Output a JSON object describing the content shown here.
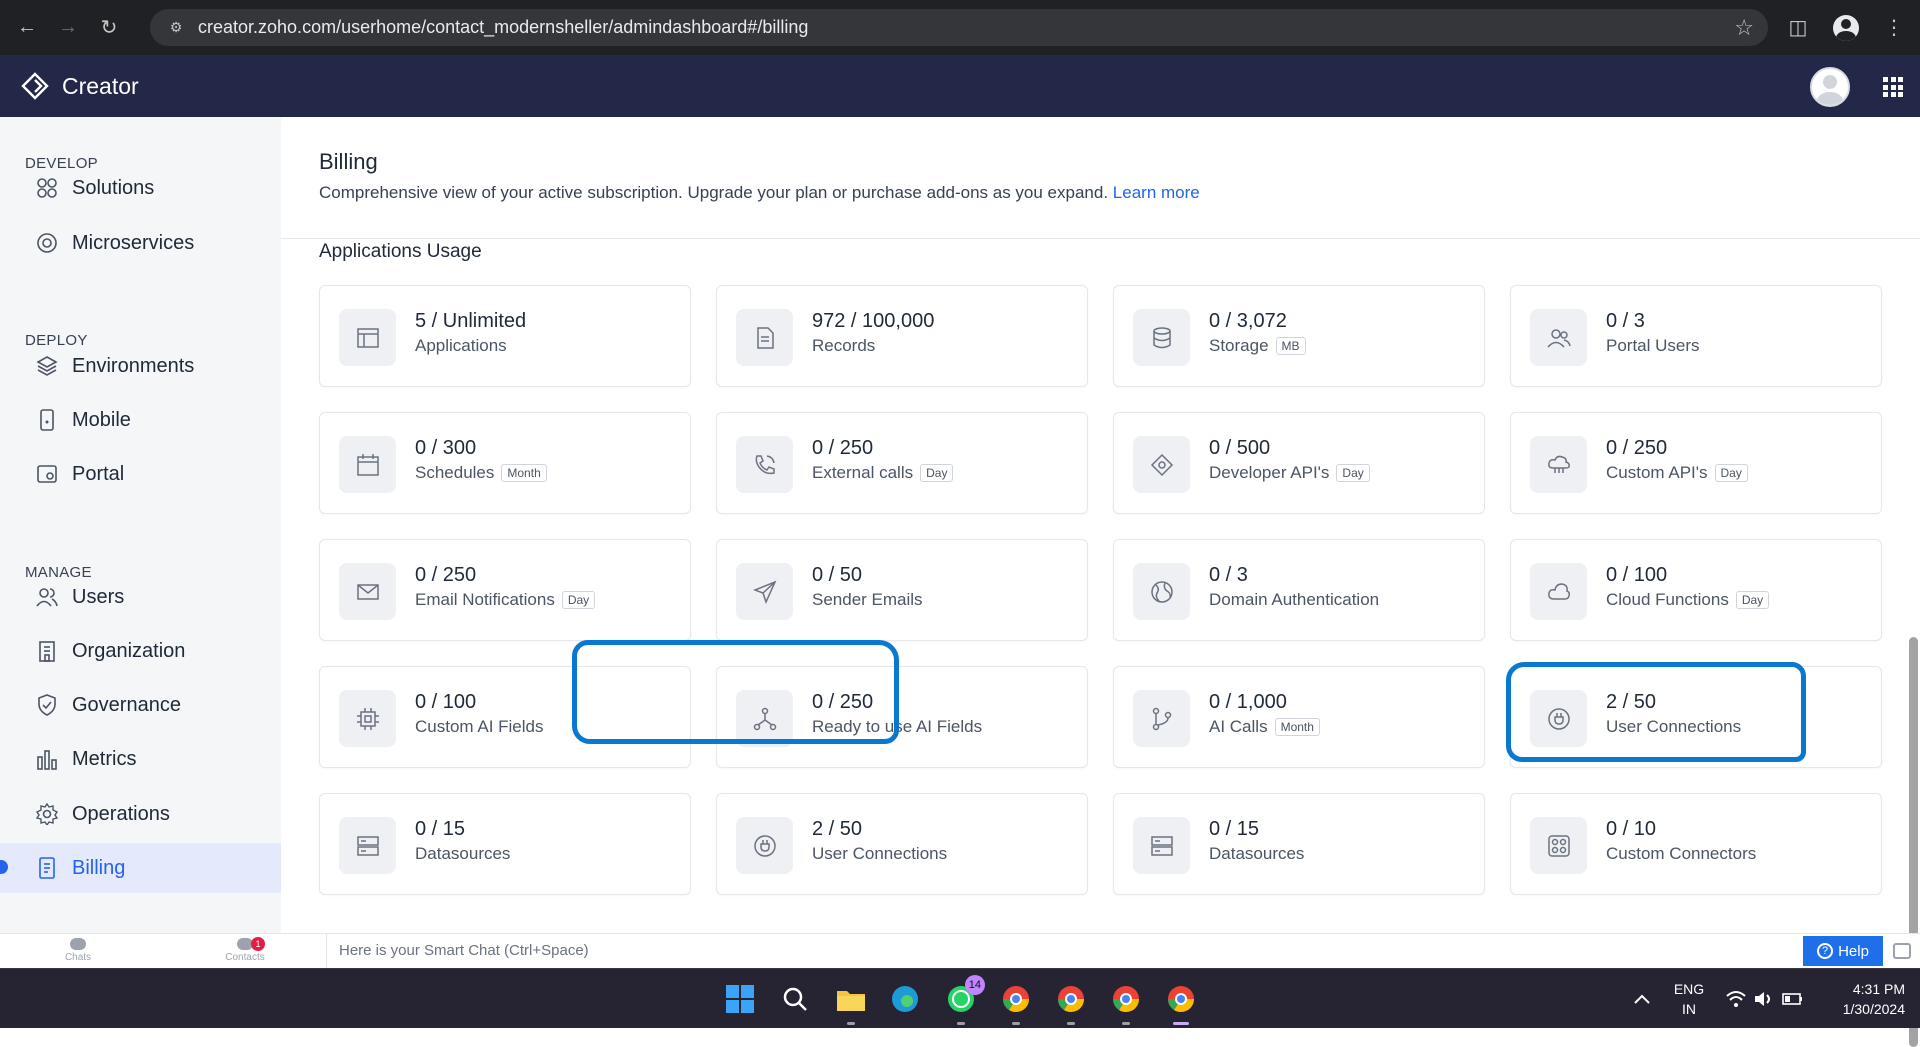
{
  "browser": {
    "url": "creator.zoho.com/userhome/contact_modernsheller/admindashboard#/billing"
  },
  "app": {
    "name": "Creator"
  },
  "sidebar": {
    "sections": [
      {
        "title": "DEVELOP",
        "items": [
          {
            "label": "Solutions",
            "icon": "solutions-icon"
          },
          {
            "label": "Microservices",
            "icon": "microservices-icon"
          }
        ]
      },
      {
        "title": "DEPLOY",
        "items": [
          {
            "label": "Environments",
            "icon": "environments-icon"
          },
          {
            "label": "Mobile",
            "icon": "mobile-icon"
          },
          {
            "label": "Portal",
            "icon": "portal-icon"
          }
        ]
      },
      {
        "title": "MANAGE",
        "items": [
          {
            "label": "Users",
            "icon": "users-icon"
          },
          {
            "label": "Organization",
            "icon": "organization-icon"
          },
          {
            "label": "Governance",
            "icon": "governance-icon"
          },
          {
            "label": "Metrics",
            "icon": "metrics-icon"
          },
          {
            "label": "Operations",
            "icon": "operations-icon"
          },
          {
            "label": "Billing",
            "icon": "billing-icon",
            "active": true
          }
        ]
      }
    ]
  },
  "page": {
    "title": "Billing",
    "description": "Comprehensive view of your active subscription. Upgrade your plan or purchase add-ons as you expand.",
    "learn_more": "Learn more",
    "section_title": "Applications Usage"
  },
  "usage_cards": [
    {
      "value": "5 / Unlimited",
      "label": "Applications",
      "tag": "",
      "icon": "applications-icon"
    },
    {
      "value": "972 / 100,000",
      "label": "Records",
      "tag": "",
      "icon": "records-icon"
    },
    {
      "value": "0 / 3,072",
      "label": "Storage",
      "tag": "MB",
      "icon": "storage-icon"
    },
    {
      "value": "0 / 3",
      "label": "Portal Users",
      "tag": "",
      "icon": "portal-users-icon"
    },
    {
      "value": "0 / 300",
      "label": "Schedules",
      "tag": "Month",
      "icon": "calendar-icon"
    },
    {
      "value": "0 / 250",
      "label": "External calls",
      "tag": "Day",
      "icon": "phone-icon"
    },
    {
      "value": "0 / 500",
      "label": "Developer API's",
      "tag": "Day",
      "icon": "developer-api-icon"
    },
    {
      "value": "0 / 250",
      "label": "Custom API's",
      "tag": "Day",
      "icon": "cloud-api-icon"
    },
    {
      "value": "0 / 250",
      "label": "Email Notifications",
      "tag": "Day",
      "icon": "mail-icon"
    },
    {
      "value": "0 / 50",
      "label": "Sender Emails",
      "tag": "",
      "icon": "send-icon"
    },
    {
      "value": "0 / 3",
      "label": "Domain Authentication",
      "tag": "",
      "icon": "globe-icon"
    },
    {
      "value": "0 / 100",
      "label": "Cloud Functions",
      "tag": "Day",
      "icon": "cloud-icon"
    },
    {
      "value": "0 / 100",
      "label": "Custom AI Fields",
      "tag": "",
      "icon": "chip-icon"
    },
    {
      "value": "0 / 250",
      "label": "Ready to use AI Fields",
      "tag": "",
      "icon": "nodes-icon"
    },
    {
      "value": "0 / 1,000",
      "label": "AI Calls",
      "tag": "Month",
      "icon": "branch-icon"
    },
    {
      "value": "2 / 50",
      "label": "User Connections",
      "tag": "",
      "icon": "plug-icon"
    },
    {
      "value": "0 / 15",
      "label": "Datasources",
      "tag": "",
      "icon": "server-icon"
    },
    {
      "value": "2 / 50",
      "label": "User Connections",
      "tag": "",
      "icon": "plug-icon"
    },
    {
      "value": "0 / 15",
      "label": "Datasources",
      "tag": "",
      "icon": "server-icon"
    },
    {
      "value": "0 / 10",
      "label": "Custom Connectors",
      "tag": "",
      "icon": "connectors-icon"
    }
  ],
  "bottom_bar": {
    "chats_label": "Chats",
    "contacts_label": "Contacts",
    "contacts_badge": "1",
    "smart_chat_placeholder": "Here is your Smart Chat (Ctrl+Space)",
    "help_label": "Help"
  },
  "taskbar": {
    "whatsapp_badge": "14",
    "lang_line1": "ENG",
    "lang_line2": "IN",
    "time": "4:31 PM",
    "date": "1/30/2024"
  },
  "colors": {
    "header_bg": "#242848",
    "accent": "#2563eb",
    "annotation": "#0a78d1"
  }
}
